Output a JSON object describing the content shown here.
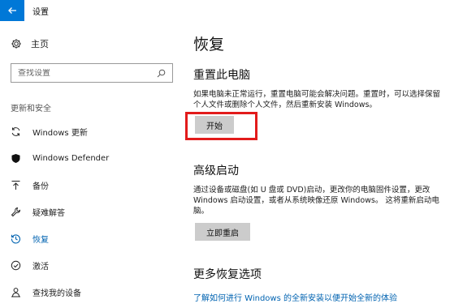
{
  "window": {
    "title": "设置"
  },
  "sidebar": {
    "home_label": "主页",
    "search_placeholder": "查找设置",
    "section_label": "更新和安全",
    "items": [
      {
        "label": "Windows 更新",
        "icon": "sync-icon"
      },
      {
        "label": "Windows Defender",
        "icon": "shield-icon"
      },
      {
        "label": "备份",
        "icon": "upload-arrow-icon"
      },
      {
        "label": "疑难解答",
        "icon": "wrench-icon"
      },
      {
        "label": "恢复",
        "icon": "history-icon",
        "active": true
      },
      {
        "label": "激活",
        "icon": "check-circle-icon"
      },
      {
        "label": "查找我的设备",
        "icon": "person-location-icon"
      }
    ]
  },
  "main": {
    "title": "恢复",
    "reset": {
      "heading": "重置此电脑",
      "description": "如果电脑未正常运行，重置电脑可能会解决问题。重置时，可以选择保留个人文件或删除个人文件，然后重新安装 Windows。",
      "button": "开始"
    },
    "advanced": {
      "heading": "高级启动",
      "description": "通过设备或磁盘(如 U 盘或 DVD)启动，更改你的电脑固件设置，更改 Windows 启动设置，或者从系统映像还原 Windows。 这将重新启动电脑。",
      "button": "立即重启"
    },
    "more": {
      "heading": "更多恢复选项",
      "link": "了解如何进行 Windows 的全新安装以便开始全新的体验"
    }
  },
  "colors": {
    "accent": "#0078d7",
    "active": "#0063b1",
    "highlight": "#e21b1b",
    "button_bg": "#cccccc"
  }
}
